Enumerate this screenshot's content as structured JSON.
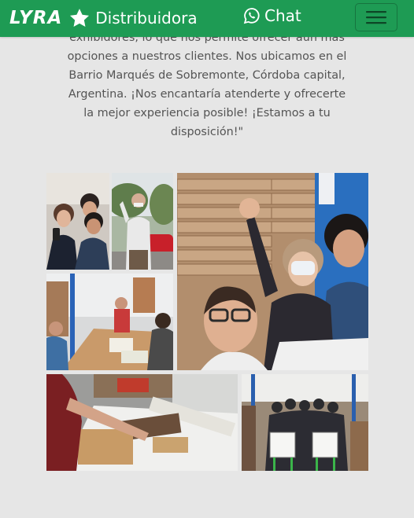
{
  "navbar": {
    "logo": "LYRA",
    "brand_label": "Distribuidora",
    "chat_label": "Chat"
  },
  "intro": {
    "text": "exhibidores, lo que nos permite ofrecer aún más opciones a nuestros clientes. Nos ubicamos en el Barrio Marqués de Sobremonte, Córdoba capital, Argentina. ¡Nos encantaría atenderte y ofrecerte la mejor experiencia posible! ¡Estamos a tu disposición!\""
  },
  "colors": {
    "navbar": "#1e9b54",
    "page_background": "#e6e6e6",
    "body_text": "#545454"
  },
  "gallery": {
    "photos": [
      "team-selfie-photo",
      "man-waving-photo",
      "workshop-table-photo",
      "group-stacked-boards-photo",
      "carpentry-cutting-photo",
      "group-whiteboards-photo"
    ]
  }
}
